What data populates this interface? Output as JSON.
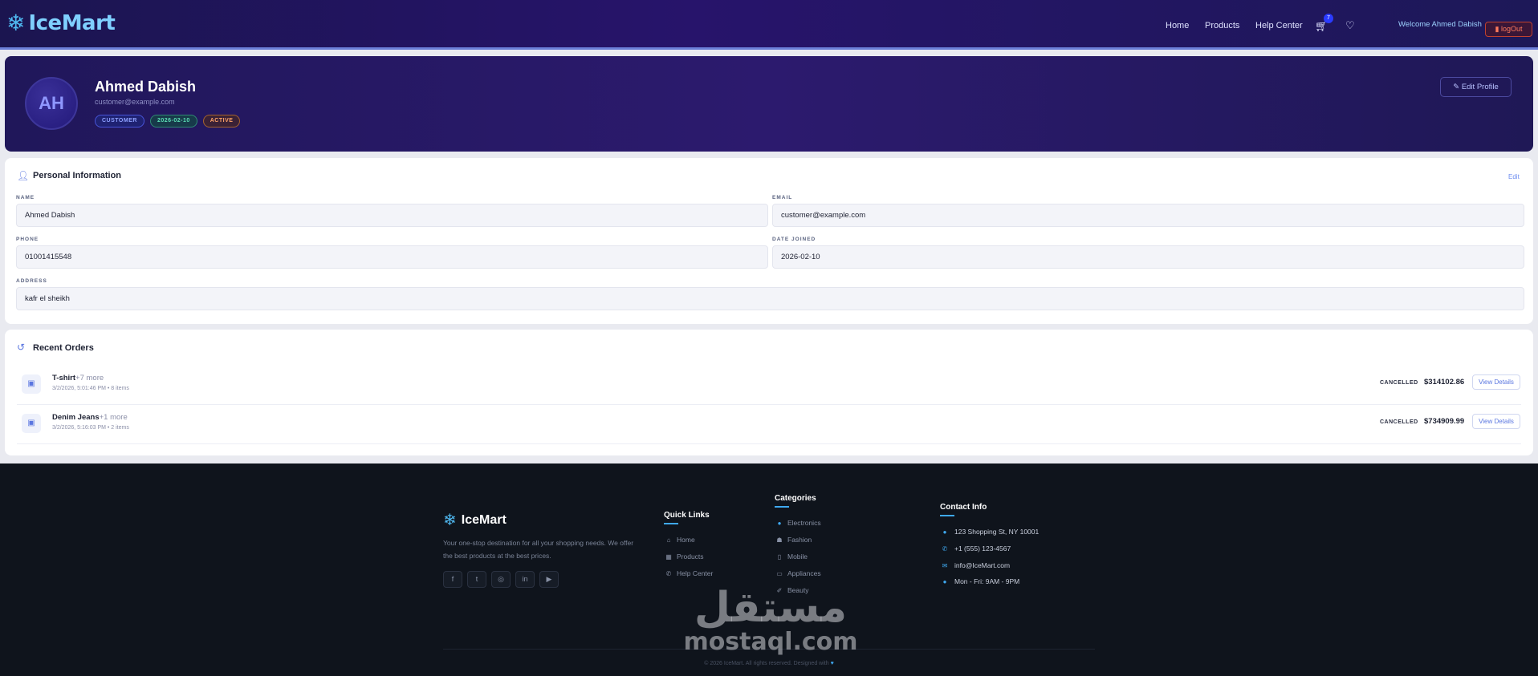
{
  "navbar": {
    "brand": "IceMart",
    "links": [
      "Home",
      "Products",
      "Help Center"
    ],
    "cart_count": "7",
    "welcome": "Welcome Ahmed Dabish",
    "logout": "logOut"
  },
  "profile": {
    "initials": "AH",
    "name": "Ahmed Dabish",
    "email": "customer@example.com",
    "badges": {
      "role": "CUSTOMER",
      "date": "2026-02-10",
      "status": "ACTIVE"
    },
    "edit_button": "Edit Profile"
  },
  "personal_info": {
    "title": "Personal Information",
    "edit": "Edit",
    "fields": {
      "name": {
        "label": "NAME",
        "value": "Ahmed Dabish"
      },
      "email": {
        "label": "EMAIL",
        "value": "customer@example.com"
      },
      "phone": {
        "label": "PHONE",
        "value": "01001415548"
      },
      "date_joined": {
        "label": "DATE JOINED",
        "value": "2026-02-10"
      },
      "address": {
        "label": "ADDRESS",
        "value": "kafr el sheikh"
      }
    }
  },
  "recent_orders": {
    "title": "Recent Orders",
    "orders": [
      {
        "name": "T-shirt",
        "more": "+7 more",
        "meta": "3/2/2026, 5:01:46 PM • 8 items",
        "status": "CANCELLED",
        "price": "$314102.86",
        "button": "View Details"
      },
      {
        "name": "Denim Jeans",
        "more": "+1 more",
        "meta": "3/2/2026, 5:16:03 PM • 2 items",
        "status": "CANCELLED",
        "price": "$734909.99",
        "button": "View Details"
      }
    ]
  },
  "footer": {
    "brand": "IceMart",
    "description": "Your one-stop destination for all your shopping needs. We offer the best products at the best prices.",
    "socials": [
      "facebook-icon",
      "twitter-icon",
      "instagram-icon",
      "linkedin-icon",
      "youtube-icon"
    ],
    "quick_links": {
      "title": "Quick Links",
      "items": [
        "Home",
        "Products",
        "Help Center"
      ]
    },
    "categories": {
      "title": "Categories",
      "items": [
        "Electronics",
        "Fashion",
        "Mobile",
        "Appliances",
        "Beauty"
      ]
    },
    "contact": {
      "title": "Contact Info",
      "items": [
        "123 Shopping St, NY 10001",
        "+1 (555) 123-4567",
        "info@IceMart.com",
        "Mon - Fri: 9AM - 9PM"
      ]
    },
    "copyright": "© 2026 IceMart. All rights reserved. Designed with"
  },
  "watermark": {
    "arabic": "مستقل",
    "latin": "mostaql.com"
  },
  "colors": {
    "accent": "#3fa9f0",
    "nav_bg": "#1b1550",
    "brand": "#7fd0ff"
  }
}
